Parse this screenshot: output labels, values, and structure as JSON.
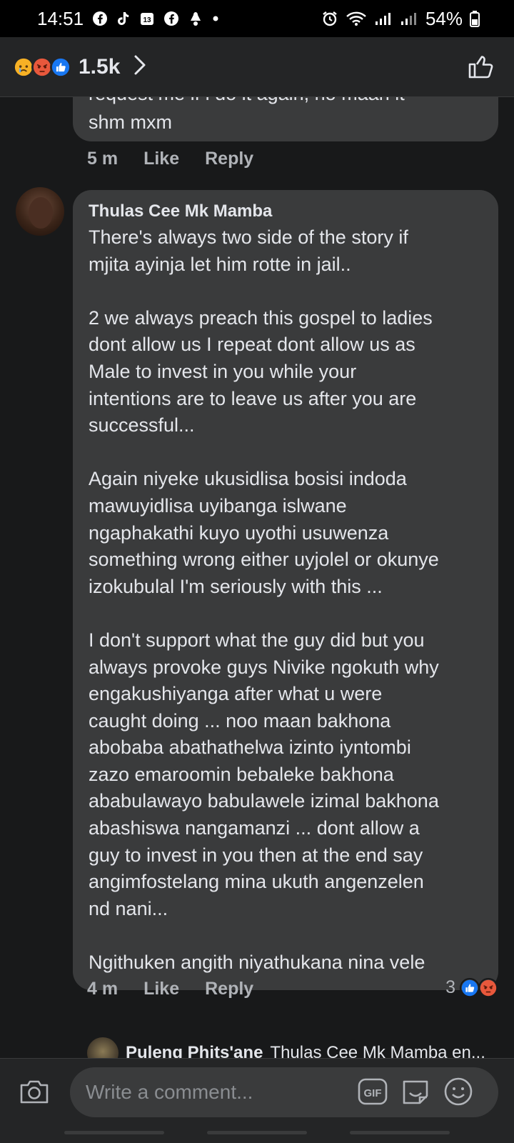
{
  "status_bar": {
    "time": "14:51",
    "battery": "54%",
    "notification_icons": [
      "facebook-icon",
      "tiktok-icon",
      "calendar-icon",
      "facebook-icon",
      "messenger-icon",
      "dot-icon"
    ],
    "calendar_day": "13"
  },
  "reactions_header": {
    "reactions": [
      "sad",
      "angry",
      "like"
    ],
    "count": "1.5k"
  },
  "previous_comment": {
    "text_partial": "request me if i do it again, no maan it",
    "text_last_line": "shm mxm",
    "time": "5 m",
    "like_label": "Like",
    "reply_label": "Reply"
  },
  "comment": {
    "author": "Thulas Cee Mk Mamba",
    "text": "There's always two side of the story if\nmjita ayinja let him rotte in jail..\n\n2 we always preach this gospel to ladies\ndont allow us I repeat dont allow us as\nMale to invest in you while your\nintentions are to leave us after you are\nsuccessful...\n\nAgain niyeke ukusidlisa bosisi indoda\nmawuyidlisa uyibanga islwane\nngaphakathi kuyo uyothi usuwenza\nsomething wrong either uyjolel or okunye\nizokubulal I'm seriously with this ...\n\nI don't support what the guy did but you\nalways provoke guys Nivike ngokuth why\nengakushiyanga after what u were\ncaught doing ... noo maan bakhona\nabobaba abathathelwa izinto iyntombi\nzazo emaroomin bebaleke bakhona\nababulawayo babulawele izimal bakhona\nabashiswa nangamanzi ... dont allow a\nguy to invest in you then at the end say\nangimfostelang mina ukuth angenzelen\nnd nani...\n\nNgithuken angith niyathukana nina vele",
    "time": "4 m",
    "like_label": "Like",
    "reply_label": "Reply",
    "reaction_count": "3",
    "reactions": [
      "like",
      "angry"
    ]
  },
  "reply_preview": {
    "author": "Puleng Phits'ane",
    "snippet": "Thulas Cee Mk Mamba en..."
  },
  "composer": {
    "placeholder": "Write a comment...",
    "gif_label": "GIF"
  },
  "colors": {
    "background": "#18191a",
    "bubble": "#3a3b3c",
    "header": "#242526",
    "like_blue": "#1877f2",
    "angry_orange": "#e8583c",
    "sad_yellow": "#f7b125"
  }
}
